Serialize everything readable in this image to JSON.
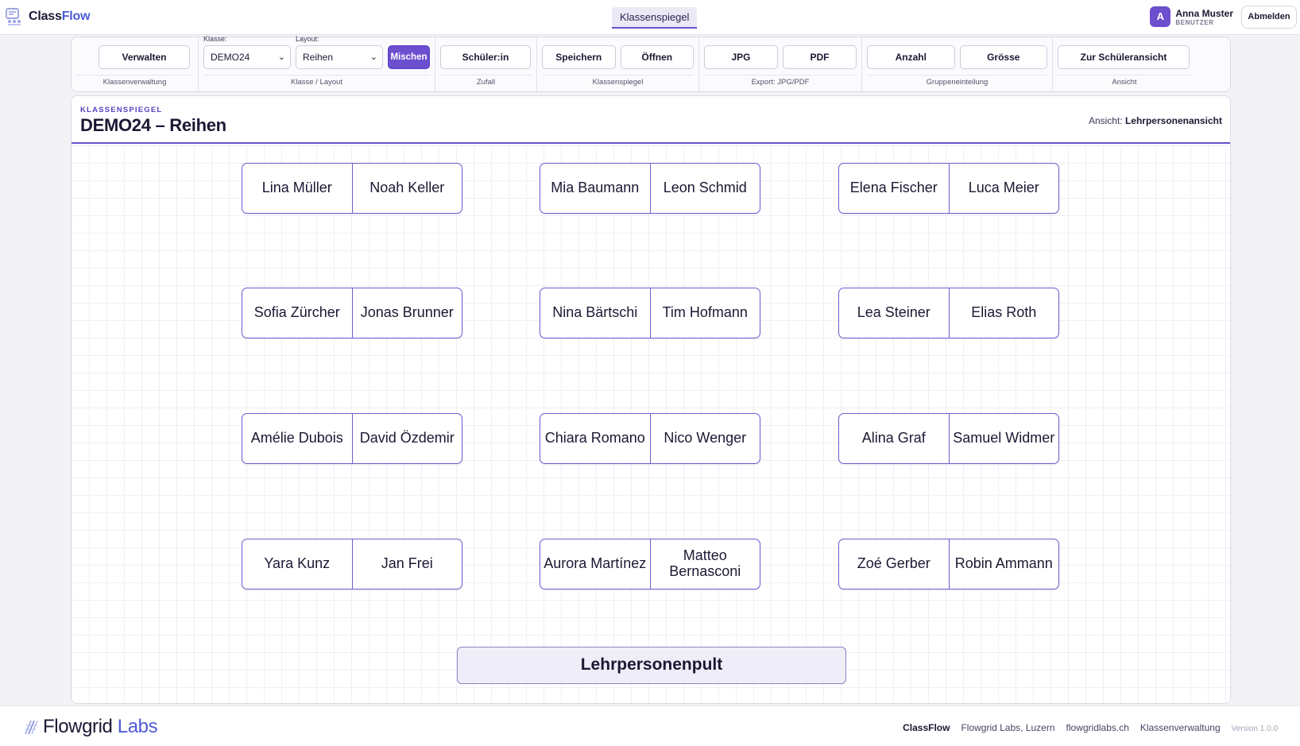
{
  "app": {
    "brand_main": "Class",
    "brand_accent": "Flow",
    "active_tab": "Klassenspiegel"
  },
  "user": {
    "initial": "A",
    "name": "Anna Muster",
    "role": "BENUTZER",
    "logout": "Abmelden"
  },
  "toolbar": {
    "klassenverwaltung": {
      "button": "Verwalten",
      "label": "Klassenverwaltung"
    },
    "klasse_layout": {
      "klasse_label": "Klasse:",
      "klasse_value": "DEMO24",
      "layout_label": "Layout:",
      "layout_value": "Reihen",
      "shuffle": "Mischen",
      "label": "Klasse / Layout"
    },
    "zufall": {
      "button": "Schüler:in",
      "label": "Zufall"
    },
    "klassenspiegel": {
      "save": "Speichern",
      "open": "Öffnen",
      "label": "Klassenspiegel"
    },
    "export": {
      "jpg": "JPG",
      "pdf": "PDF",
      "label": "Export: JPG/PDF"
    },
    "gruppen": {
      "count": "Anzahl",
      "size": "Grösse",
      "label": "Gruppeneinteilung"
    },
    "ansicht": {
      "button": "Zur Schüleransicht",
      "label": "Ansicht"
    }
  },
  "panel": {
    "eyebrow": "KLASSENSPIEGEL",
    "title": "DEMO24 – Reihen",
    "view_prefix": "Ansicht:",
    "view_value": "Lehrpersonenansicht",
    "teacher_desk": "Lehrpersonenpult"
  },
  "desks": [
    [
      "Lina Müller",
      "Noah Keller"
    ],
    [
      "Mia Baumann",
      "Leon Schmid"
    ],
    [
      "Elena Fischer",
      "Luca Meier"
    ],
    [
      "Sofia Zürcher",
      "Jonas Brunner"
    ],
    [
      "Nina Bärtschi",
      "Tim Hofmann"
    ],
    [
      "Lea Steiner",
      "Elias Roth"
    ],
    [
      "Amélie Dubois",
      "David Özdemir"
    ],
    [
      "Chiara Romano",
      "Nico Wenger"
    ],
    [
      "Alina Graf",
      "Samuel Widmer"
    ],
    [
      "Yara Kunz",
      "Jan Frei"
    ],
    [
      "Aurora Martínez",
      "Matteo Bernasconi"
    ],
    [
      "Zoé Gerber",
      "Robin Ammann"
    ]
  ],
  "footer": {
    "brand_main": "Flowgrid",
    "brand_accent": "Labs",
    "links": [
      "ClassFlow",
      "Flowgrid Labs, Luzern",
      "flowgridlabs.ch",
      "Klassenverwaltung"
    ],
    "version": "Version 1.0.0"
  },
  "colors": {
    "accent": "#6b4fcf",
    "brand_blue": "#4f5bd5",
    "desk_border": "#6b5fd0"
  }
}
